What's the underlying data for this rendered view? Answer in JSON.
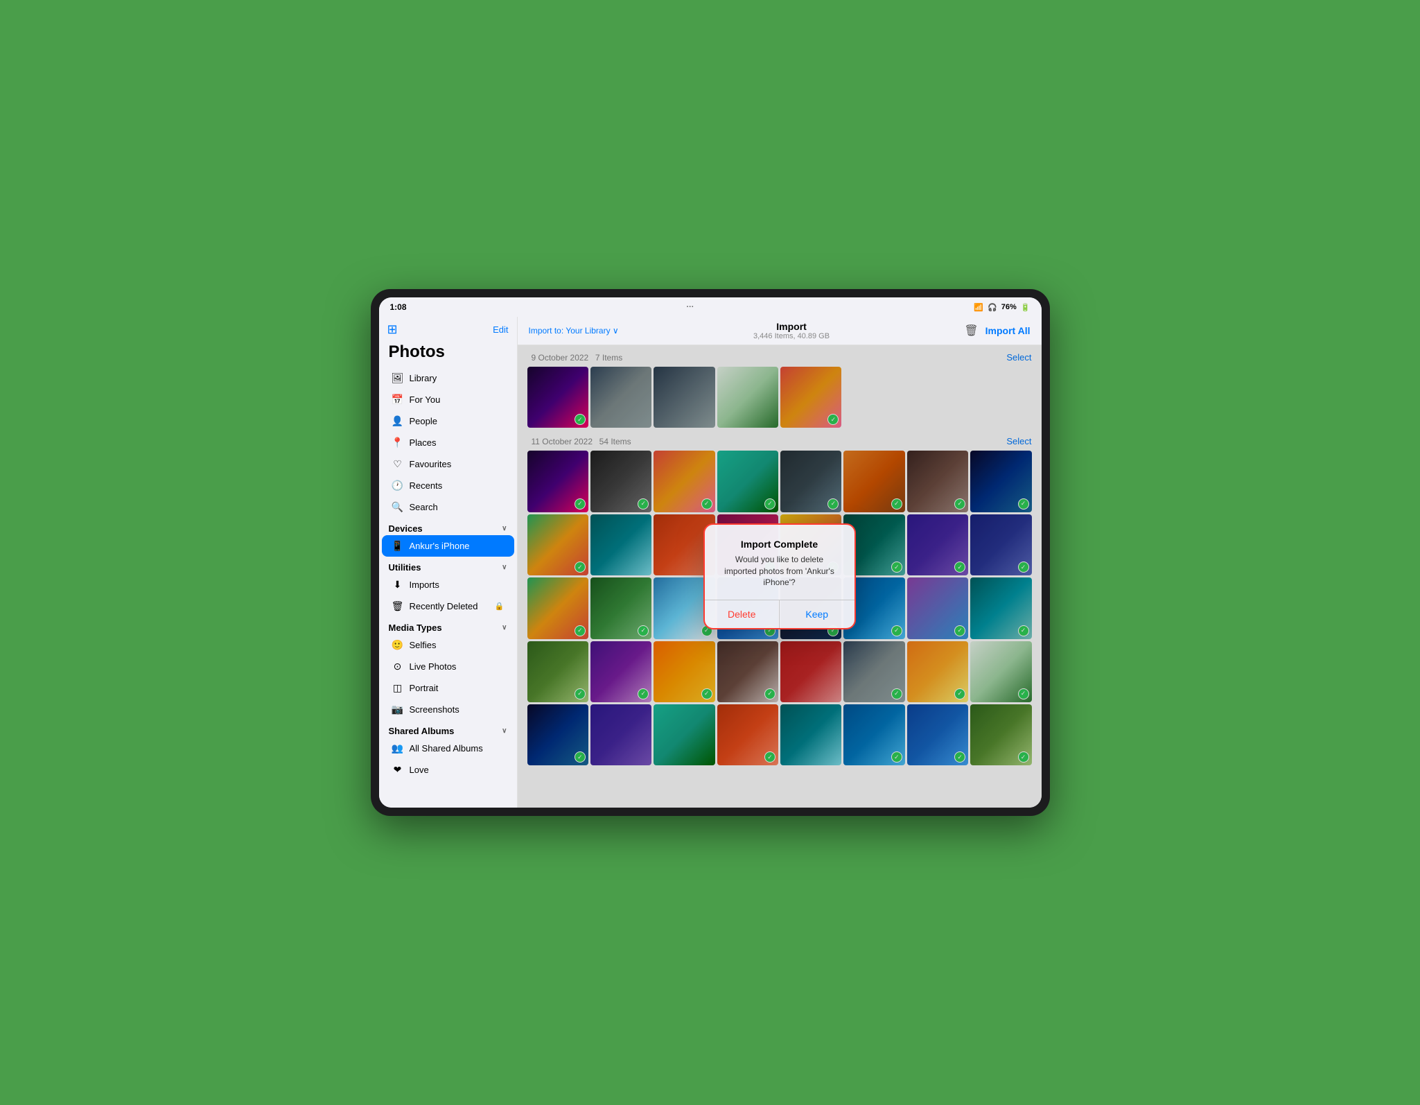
{
  "statusBar": {
    "time": "1:08",
    "wifi": "WiFi",
    "headphones": "♡",
    "battery": "76%",
    "dots": "···"
  },
  "sidebar": {
    "title": "Photos",
    "editLabel": "Edit",
    "toggleIcon": "⊞",
    "items": [
      {
        "id": "library",
        "label": "Library",
        "icon": "📷"
      },
      {
        "id": "for-you",
        "label": "For You",
        "icon": "📅"
      },
      {
        "id": "people",
        "label": "People",
        "icon": "👤"
      },
      {
        "id": "places",
        "label": "Places",
        "icon": "📍"
      },
      {
        "id": "favourites",
        "label": "Favourites",
        "icon": "♡"
      },
      {
        "id": "recents",
        "label": "Recents",
        "icon": "🕐"
      },
      {
        "id": "search",
        "label": "Search",
        "icon": "🔍"
      }
    ],
    "devicesSection": {
      "label": "Devices",
      "chevron": "∨",
      "items": [
        {
          "id": "ankurs-iphone",
          "label": "Ankur's iPhone",
          "icon": "📱",
          "active": true
        }
      ]
    },
    "utilitiesSection": {
      "label": "Utilities",
      "chevron": "∨",
      "items": [
        {
          "id": "imports",
          "label": "Imports",
          "icon": "⬇"
        },
        {
          "id": "recently-deleted",
          "label": "Recently Deleted",
          "icon": "🗑",
          "badge": "🔒"
        }
      ]
    },
    "mediaTypesSection": {
      "label": "Media Types",
      "chevron": "∨",
      "items": [
        {
          "id": "selfies",
          "label": "Selfies",
          "icon": "🙂"
        },
        {
          "id": "live-photos",
          "label": "Live Photos",
          "icon": "⊙"
        },
        {
          "id": "portrait",
          "label": "Portrait",
          "icon": "◫"
        },
        {
          "id": "screenshots",
          "label": "Screenshots",
          "icon": "📷"
        }
      ]
    },
    "sharedAlbumsSection": {
      "label": "Shared Albums",
      "chevron": "∨",
      "items": [
        {
          "id": "all-shared-albums",
          "label": "All Shared Albums",
          "icon": "👥"
        },
        {
          "id": "love",
          "label": "Love",
          "icon": "❤"
        }
      ]
    }
  },
  "header": {
    "importTo": "Import to:",
    "library": "Your Library",
    "dropdownIcon": "∨",
    "title": "Import",
    "subtitle": "3,446 Items, 40.89 GB",
    "importAllLabel": "Import All"
  },
  "sections": [
    {
      "date": "9 October 2022",
      "items": "7 Items",
      "selectLabel": "Select"
    },
    {
      "date": "11 October 2022",
      "items": "54 Items",
      "selectLabel": "Select"
    }
  ],
  "dialog": {
    "title": "Import Complete",
    "message": "Would you like to delete imported photos from 'Ankur's iPhone'?",
    "deleteLabel": "Delete",
    "keepLabel": "Keep"
  },
  "photoColors": [
    "c1",
    "c2",
    "c3",
    "c4",
    "c5",
    "c6",
    "c7",
    "c8",
    "c9",
    "c10",
    "c11",
    "c12",
    "c13",
    "c14",
    "c15",
    "c16",
    "c17",
    "c18",
    "c19",
    "c20",
    "c21",
    "c22",
    "c23",
    "c24",
    "c25",
    "c26",
    "c27",
    "c28",
    "c29",
    "c30",
    "c31",
    "c32"
  ]
}
